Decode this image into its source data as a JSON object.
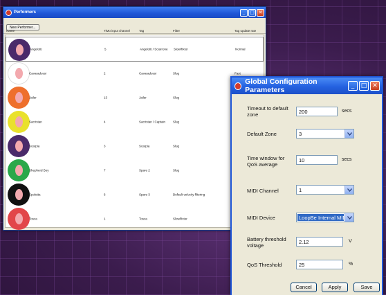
{
  "performers_window": {
    "title": "Performers",
    "new_button": "New Performer...",
    "columns": [
      "Name",
      "TiMo input channel",
      "Tag",
      "Filter",
      "Tag update rate"
    ],
    "rows": [
      {
        "name": "Angelotti",
        "channel": "5",
        "tag": "Angelotti / Sciarrone",
        "filter": "Slow/fixtor",
        "rate": "Normal",
        "ring": "#4a2a6a",
        "selected": true
      },
      {
        "name": "Cavaradossi",
        "channel": "2",
        "tag": "Cavaradossi",
        "filter": "Slug",
        "rate": "Fast",
        "ring": "#ffffff",
        "selected": false
      },
      {
        "name": "Jailer",
        "channel": "13",
        "tag": "Jailer",
        "filter": "Slug",
        "rate": "",
        "ring": "#ee6f2c",
        "selected": false
      },
      {
        "name": "Sacristan",
        "channel": "4",
        "tag": "Sacristan / Captain",
        "filter": "Slug",
        "rate": "",
        "ring": "#e9e12c",
        "selected": false
      },
      {
        "name": "Scarpia",
        "channel": "3",
        "tag": "Scarpia",
        "filter": "Slug",
        "rate": "",
        "ring": "#4a2a6a",
        "selected": false
      },
      {
        "name": "Shepherd Boy",
        "channel": "7",
        "tag": "Spare 2",
        "filter": "Slug",
        "rate": "",
        "ring": "#2aa84a",
        "selected": false
      },
      {
        "name": "Spoletta",
        "channel": "6",
        "tag": "Spare 3",
        "filter": "Default velocity filtering",
        "rate": "",
        "ring": "#111111",
        "selected": false
      },
      {
        "name": "Tosca",
        "channel": "1",
        "tag": "Tosca",
        "filter": "Slow/fixtor",
        "rate": "",
        "ring": "#e2464a",
        "selected": false
      }
    ]
  },
  "config_dialog": {
    "title": "Global Configuration Parameters",
    "timeout": {
      "label": "Timeout to default zone",
      "value": "200",
      "unit": "secs"
    },
    "default_zone": {
      "label": "Default Zone",
      "value": "3"
    },
    "time_window": {
      "label": "Time window for QoS average",
      "value": "10",
      "unit": "secs"
    },
    "midi_channel": {
      "label": "MIDI Channel",
      "value": "1"
    },
    "midi_device": {
      "label": "MIDI Device",
      "value": "LoopBe Internal MIDI"
    },
    "battery": {
      "label": "Battery threshold voltage",
      "value": "2.12",
      "unit": "V"
    },
    "qos": {
      "label": "QoS Threshold",
      "value": "25",
      "unit": "%"
    },
    "buttons": {
      "cancel": "Cancel",
      "apply": "Apply",
      "save": "Save"
    }
  },
  "window_buttons": {
    "minimize": "_",
    "maximize": "□",
    "close": "✕"
  },
  "colors": {
    "titlebar": "#2461e0",
    "avatar_inner": "#f3a9ae",
    "selection": "#316ac5"
  }
}
